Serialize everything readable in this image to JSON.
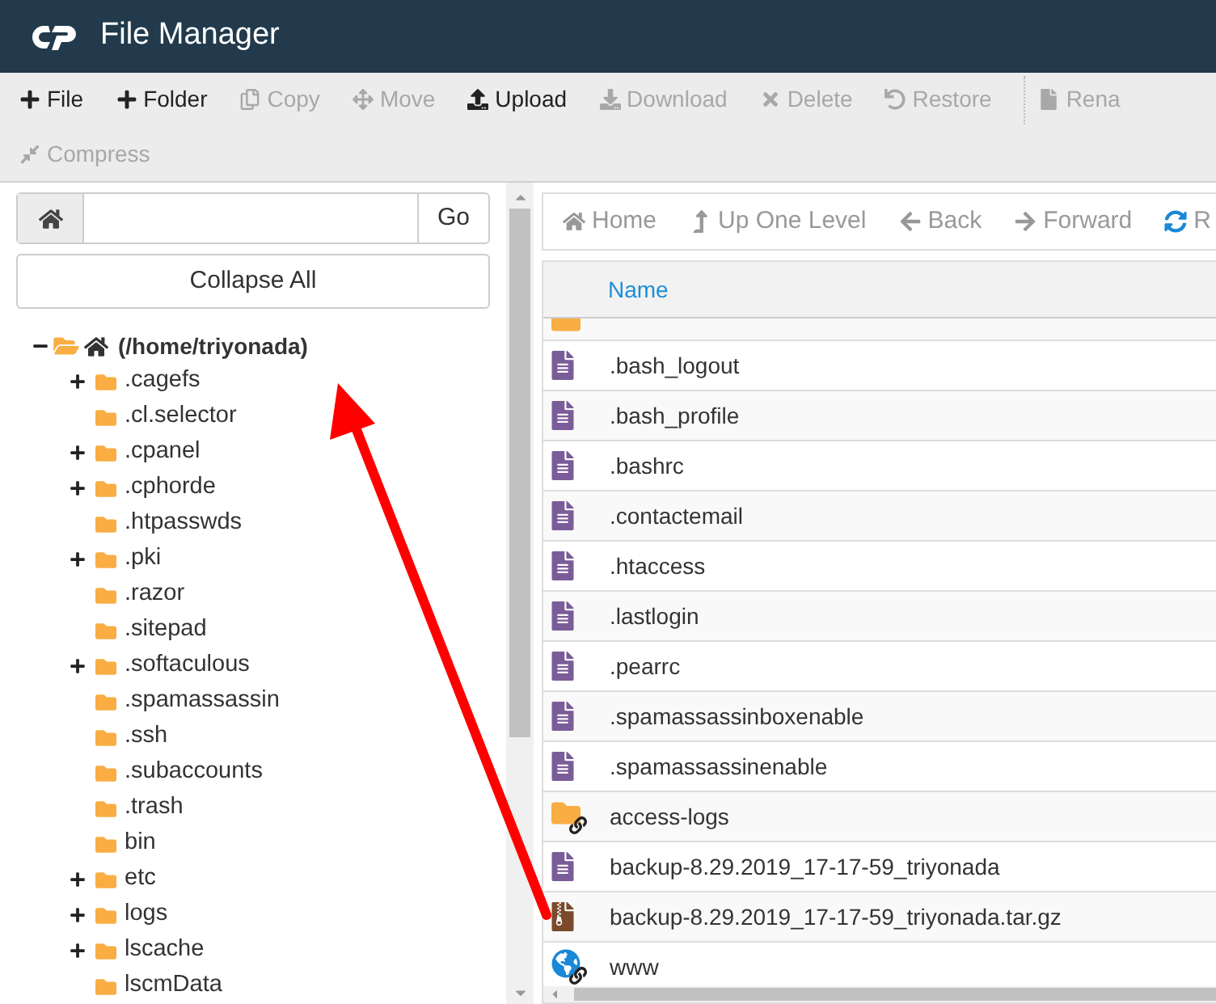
{
  "header": {
    "title": "File Manager"
  },
  "toolbar": {
    "rows": [
      {
        "items": [
          {
            "kind": "plus",
            "label": "File",
            "disabled": false
          },
          {
            "kind": "plus",
            "label": "Folder",
            "disabled": false
          },
          {
            "kind": "copy",
            "label": "Copy",
            "disabled": true
          },
          {
            "kind": "move",
            "label": "Move",
            "disabled": true
          },
          {
            "kind": "upload",
            "label": "Upload",
            "disabled": false
          },
          {
            "kind": "download",
            "label": "Download",
            "disabled": true
          },
          {
            "kind": "delete",
            "label": "Delete",
            "disabled": true
          },
          {
            "kind": "restore",
            "label": "Restore",
            "disabled": true
          },
          {
            "kind": "rename",
            "label": "Rena",
            "disabled": true
          }
        ]
      },
      {
        "items": [
          {
            "kind": "compress",
            "label": "Compress",
            "disabled": true
          }
        ]
      }
    ]
  },
  "path_bar": {
    "button": "Go"
  },
  "collapse_button": "Collapse All",
  "tree": {
    "label": "(/home/triyonada)",
    "expanded": true,
    "children": [
      {
        "label": ".cagefs",
        "expandable": true
      },
      {
        "label": ".cl.selector",
        "expandable": false
      },
      {
        "label": ".cpanel",
        "expandable": true
      },
      {
        "label": ".cphorde",
        "expandable": true
      },
      {
        "label": ".htpasswds",
        "expandable": false
      },
      {
        "label": ".pki",
        "expandable": true
      },
      {
        "label": ".razor",
        "expandable": false
      },
      {
        "label": ".sitepad",
        "expandable": false
      },
      {
        "label": ".softaculous",
        "expandable": true
      },
      {
        "label": ".spamassassin",
        "expandable": false
      },
      {
        "label": ".ssh",
        "expandable": false
      },
      {
        "label": ".subaccounts",
        "expandable": false
      },
      {
        "label": ".trash",
        "expandable": false
      },
      {
        "label": "bin",
        "expandable": false
      },
      {
        "label": "etc",
        "expandable": true
      },
      {
        "label": "logs",
        "expandable": true
      },
      {
        "label": "lscache",
        "expandable": true
      },
      {
        "label": "lscmData",
        "expandable": false
      }
    ]
  },
  "nav": [
    {
      "kind": "home",
      "label": "Home"
    },
    {
      "kind": "up",
      "label": "Up One Level"
    },
    {
      "kind": "back",
      "label": "Back"
    },
    {
      "kind": "forward",
      "label": "Forward"
    },
    {
      "kind": "reload",
      "label": "R"
    }
  ],
  "table": {
    "columns": [
      "Name"
    ],
    "rows": [
      {
        "kind": "folder-partial"
      },
      {
        "kind": "file",
        "name": ".bash_logout"
      },
      {
        "kind": "file",
        "name": ".bash_profile"
      },
      {
        "kind": "file",
        "name": ".bashrc"
      },
      {
        "kind": "file",
        "name": ".contactemail"
      },
      {
        "kind": "file",
        "name": ".htaccess"
      },
      {
        "kind": "file",
        "name": ".lastlogin"
      },
      {
        "kind": "file",
        "name": ".pearrc"
      },
      {
        "kind": "file",
        "name": ".spamassassinboxenable"
      },
      {
        "kind": "file",
        "name": ".spamassassinenable"
      },
      {
        "kind": "folder-link",
        "name": "access-logs"
      },
      {
        "kind": "file",
        "name": "backup-8.29.2019_17-17-59_triyonada"
      },
      {
        "kind": "archive",
        "name": "backup-8.29.2019_17-17-59_triyonada.tar.gz"
      },
      {
        "kind": "web-link",
        "name": "www"
      }
    ]
  }
}
